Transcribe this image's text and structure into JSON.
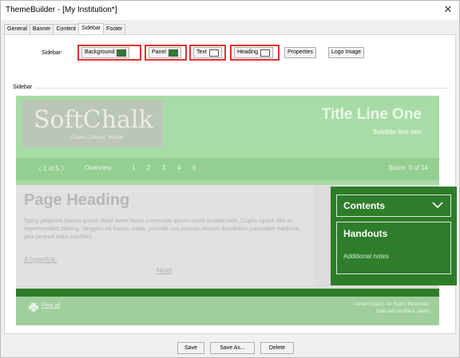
{
  "window": {
    "title": "ThemeBuilder - [My Institution*]"
  },
  "tabs": [
    "General",
    "Banner",
    "Content",
    "Sidebar",
    "Footer"
  ],
  "active_tab": "Sidebar",
  "toolbar": {
    "label": "Sidebar:",
    "background_label": "Background",
    "background_color": "#2e7d2a",
    "panel_label": "Panel",
    "panel_color": "#2e7d2a",
    "text_label": "Text",
    "text_color": "#ffffff",
    "heading_label": "Heading",
    "heading_color": "#ffffff",
    "properties_label": "Properties",
    "logo_image_label": "Logo Image"
  },
  "group": {
    "label": "Sidebar"
  },
  "preview": {
    "logo_text": "SoftChalk",
    "logo_tagline": "Create. Connect. Inspire!",
    "title_line": "Title Line One",
    "subtitle_line": "Subtitle line two",
    "nav_prev": "〈 1 of 5 〉",
    "nav_items": [
      "Overview",
      "1",
      "2",
      "3",
      "4",
      "5"
    ],
    "score": "Score: 0 of 14",
    "page_heading": "Page Heading",
    "page_body": "Spicy jalapeno bacon ipsum dolor amet kevin commodo ipsum mollit brisket velit. Cupim spare ribs et reprehenderit biltong. Veggies es bonus vobis, proinde vos postulo essum dandelion cucumber earthnut pea peanut soko zucchini.",
    "hyperlink": "A hyperlink.",
    "next": "Next",
    "sidebar_contents": "Contents",
    "sidebar_handouts": "Handouts",
    "sidebar_note": "Additional notes",
    "print": "Print all",
    "footer_line1": "Content (date). All Rights Reserved.",
    "footer_line2": "Date last modified: (date)"
  },
  "buttons": {
    "save": "Save",
    "save_as": "Save As...",
    "delete": "Delete"
  }
}
